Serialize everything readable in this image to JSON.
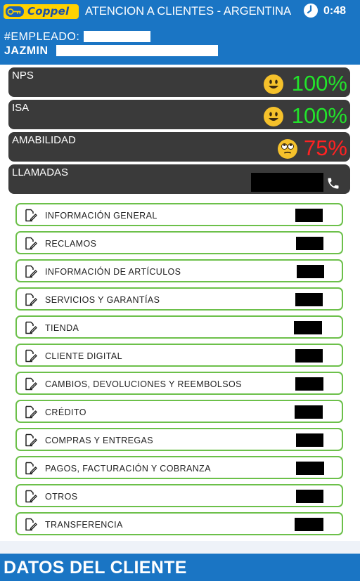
{
  "header": {
    "logo_text": "Coppel",
    "title": "ATENCION A CLIENTES - ARGENTINA",
    "timer": "0:48",
    "employee_label": "#EMPLEADO:",
    "name_label": "JAZMIN"
  },
  "metrics": [
    {
      "label": "NPS",
      "value": "100%",
      "color": "#22e32b",
      "emoji": "happy-face-icon"
    },
    {
      "label": "ISA",
      "value": "100%",
      "color": "#22e32b",
      "emoji": "happy-face-icon"
    },
    {
      "label": "AMABILIDAD",
      "value": "75%",
      "color": "#ff2222",
      "emoji": "eye-roll-face-icon"
    },
    {
      "label": "LLAMADAS",
      "value": "",
      "icon": "phone-icon"
    }
  ],
  "categories": [
    {
      "label": "INFORMACIÓN GENERAL"
    },
    {
      "label": "RECLAMOS"
    },
    {
      "label": "INFORMACIÓN DE ARTÍCULOS"
    },
    {
      "label": "SERVICIOS Y GARANTÍAS"
    },
    {
      "label": "TIENDA"
    },
    {
      "label": "CLIENTE DIGITAL"
    },
    {
      "label": "CAMBIOS, DEVOLUCIONES Y REEMBOLSOS"
    },
    {
      "label": "CRÉDITO"
    },
    {
      "label": "COMPRAS Y ENTREGAS"
    },
    {
      "label": "PAGOS, FACTURACIÓN Y COBRANZA"
    },
    {
      "label": "OTROS"
    },
    {
      "label": "TRANSFERENCIA"
    }
  ],
  "footer": {
    "title": "DATOS DEL CLIENTE"
  },
  "colors": {
    "brand_blue": "#1a75c4",
    "card_dark": "#3a3a3a",
    "category_border": "#6cc04a",
    "logo_yellow": "#ffd200"
  }
}
